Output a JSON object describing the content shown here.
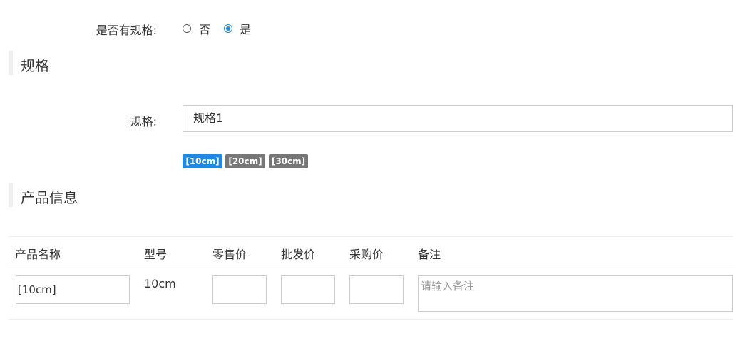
{
  "spec_toggle": {
    "label": "是否有规格:",
    "options": [
      {
        "label": "否",
        "checked": false
      },
      {
        "label": "是",
        "checked": true
      }
    ]
  },
  "spec_section": {
    "title": "规格",
    "field_label": "规格:",
    "field_value": "规格1",
    "tags": [
      {
        "label": "[10cm]",
        "active": true
      },
      {
        "label": "[20cm]",
        "active": false
      },
      {
        "label": "[30cm]",
        "active": false
      }
    ]
  },
  "product_section": {
    "title": "产品信息",
    "columns": [
      "产品名称",
      "型号",
      "零售价",
      "批发价",
      "采购价",
      "备注"
    ],
    "rows": [
      {
        "name": "[10cm]",
        "model": "10cm",
        "retail": "",
        "wholesale": "",
        "purchase": "",
        "remark_placeholder": "请输入备注"
      }
    ]
  },
  "colors": {
    "accent": "#1e88e5",
    "tag_inactive": "#777777",
    "section_bar": "#eeeeee"
  }
}
